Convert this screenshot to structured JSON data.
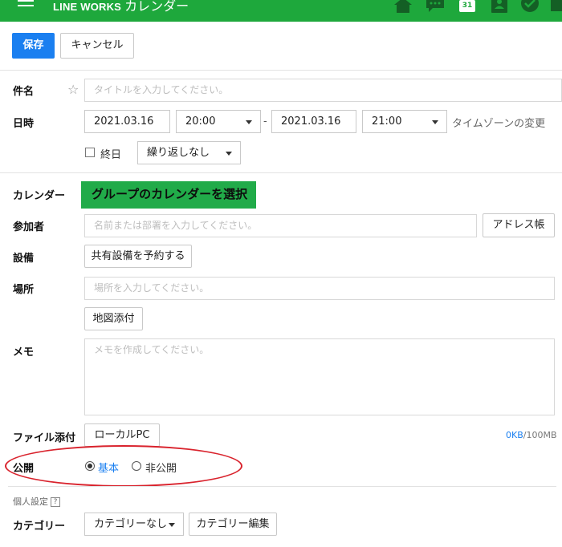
{
  "header": {
    "brand": "LINE WORKS",
    "app_name": "カレンダー",
    "calendar_badge": "31",
    "icons": [
      "home-icon",
      "chat-icon",
      "calendar-icon",
      "contacts-icon",
      "check-icon",
      "more-icon"
    ],
    "accent": "#1ea83c"
  },
  "toolbar": {
    "save_label": "保存",
    "cancel_label": "キャンセル",
    "primary_color": "#1a7ff0"
  },
  "form": {
    "subject": {
      "label": "件名",
      "placeholder": "タイトルを入力してください。"
    },
    "datetime": {
      "label": "日時",
      "start_date": "2021.03.16",
      "start_time": "20:00",
      "separator": "-",
      "end_date": "2021.03.16",
      "end_time": "21:00",
      "timezone_link": "タイムゾーンの変更",
      "all_day_label": "終日",
      "all_day_checked": false,
      "repeat_value": "繰り返しなし"
    },
    "calendar": {
      "label": "カレンダー",
      "overlay_text": "グループのカレンダーを選択"
    },
    "attendees": {
      "label": "参加者",
      "placeholder": "名前または部署を入力してください。",
      "address_book_button": "アドレス帳"
    },
    "facility": {
      "label": "設備",
      "reserve_button": "共有設備を予約する"
    },
    "location": {
      "label": "場所",
      "placeholder": "場所を入力してください。",
      "map_button": "地図添付"
    },
    "memo": {
      "label": "メモ",
      "placeholder": "メモを作成してください。"
    },
    "attachment": {
      "label": "ファイル添付",
      "local_pc_button": "ローカルPC",
      "used": "0KB",
      "limit": "/100MB"
    },
    "visibility": {
      "label": "公開",
      "options": [
        "基本",
        "非公開"
      ],
      "selected": "基本"
    },
    "personal": {
      "section_label": "個人設定",
      "help_icon_text": "?"
    },
    "category": {
      "label": "カテゴリー",
      "value": "カテゴリーなし",
      "edit_button": "カテゴリー編集"
    }
  },
  "annotation_color": "#d9232d"
}
